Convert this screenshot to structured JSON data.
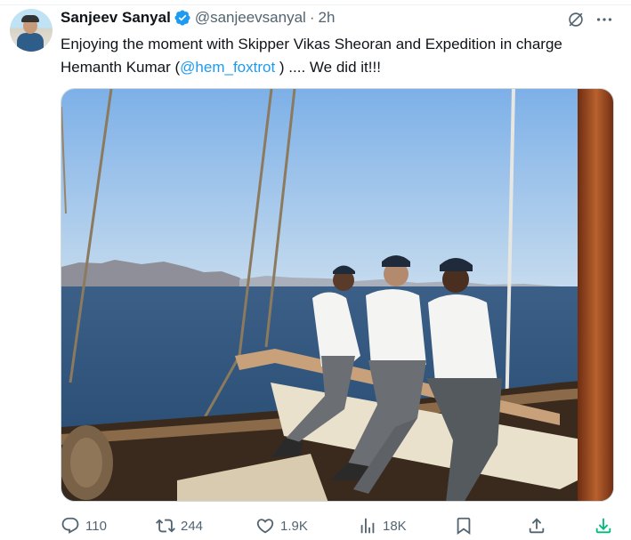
{
  "tweet": {
    "author_name": "Sanjeev Sanyal",
    "handle": "@sanjeevsanyal",
    "separator": "·",
    "time": "2h",
    "text_before": "Enjoying the moment with Skipper Vikas Sheoran and Expedition in charge Hemanth Kumar (",
    "mention": "@hem_foxtrot",
    "text_after": " ) .... We did it!!!"
  },
  "icons": {
    "verified": "verified-badge-icon",
    "grok": "grok-icon",
    "more": "more-icon",
    "reply": "reply-icon",
    "retweet": "retweet-icon",
    "like": "like-icon",
    "views": "views-icon",
    "bookmark": "bookmark-icon",
    "share": "share-icon",
    "download": "download-icon"
  },
  "actions": {
    "replies": "110",
    "retweets": "244",
    "likes": "1.9K",
    "views": "18K"
  },
  "colors": {
    "accent": "#1d9bf0",
    "text": "#0f1419",
    "secondary": "#536471",
    "download": "#00ba7c"
  }
}
